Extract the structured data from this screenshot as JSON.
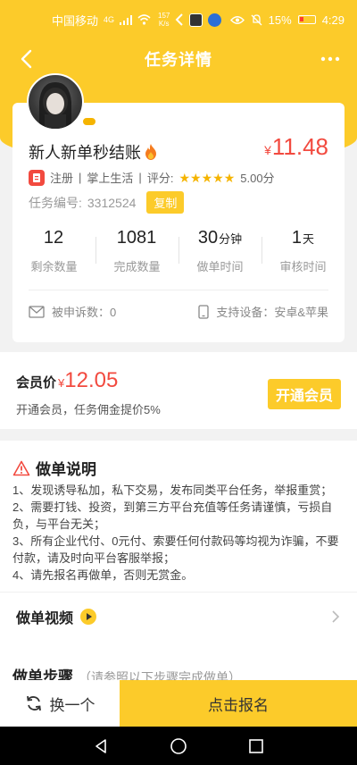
{
  "status_bar": {
    "carrier": "中国移动",
    "signal_label": "4G",
    "speed_value": "157",
    "speed_unit": "K/s",
    "battery_percent": "15%",
    "time": "4:29"
  },
  "header": {
    "title": "任务详情"
  },
  "task": {
    "title": "新人新单秒结账",
    "price_symbol": "¥",
    "price": "11.48",
    "tag_register": "注册",
    "separator": "|",
    "platform": "掌上生活",
    "rating_label": "评分:",
    "rating_stars": 5,
    "rating_score": "5.00分",
    "task_no_label": "任务编号:",
    "task_no": "3312524",
    "copy_label": "复制",
    "stats": [
      {
        "value": "12",
        "unit": "",
        "label": "剩余数量"
      },
      {
        "value": "1081",
        "unit": "",
        "label": "完成数量"
      },
      {
        "value": "30",
        "unit": "分钟",
        "label": "做单时间"
      },
      {
        "value": "1",
        "unit": "天",
        "label": "审核时间"
      }
    ],
    "complaints": "被申诉数：0",
    "devices": "支持设备：安卓&苹果"
  },
  "member": {
    "label": "会员价",
    "price_symbol": "¥",
    "price": "12.05",
    "desc": "开通会员，任务佣金提价5%",
    "button": "开通会员"
  },
  "instructions": {
    "title": "做单说明",
    "lines": [
      "1、发现诱导私加，私下交易，发布同类平台任务，举报重赏；",
      "2、需要打钱、投资，到第三方平台充值等任务请谨慎，亏损自负，与平台无关；",
      "3、所有企业代付、0元付、索要任何付款码等均视为诈骗，不要付款，请及时向平台客服举报；",
      "4、请先报名再做单，否则无赏金。"
    ],
    "video_title": "做单视频",
    "steps_title": "做单步骤",
    "steps_note": "（请参照以下步骤完成做单）"
  },
  "actions": {
    "switch": "换一个",
    "signup": "点击报名"
  },
  "colors": {
    "brand": "#fccb2a",
    "price": "#f24a3f"
  }
}
